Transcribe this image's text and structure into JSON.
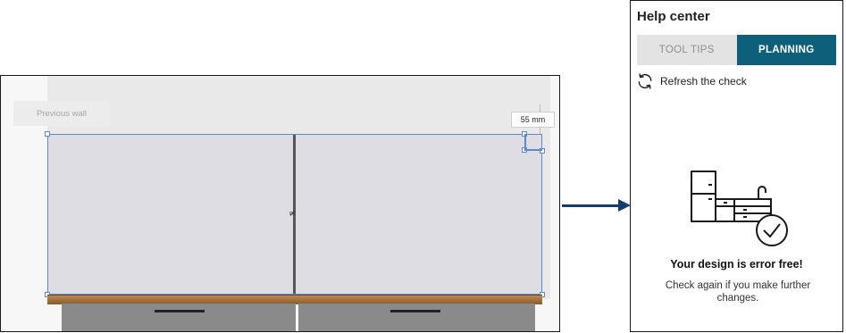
{
  "canvas": {
    "previous_wall_label": "Previous wall",
    "dimension_label": "55 mm",
    "divider_mark": "≠"
  },
  "help_center": {
    "title": "Help center",
    "tabs": [
      {
        "label": "TOOL TIPS",
        "active": false
      },
      {
        "label": "PLANNING",
        "active": true
      }
    ],
    "refresh_label": "Refresh the check",
    "refresh_icon": "refresh-icon",
    "illustration_icon": "kitchen-check-icon",
    "status_title": "Your design is error free!",
    "status_desc": "Check again if you make further changes."
  },
  "colors": {
    "accent": "#0e5f7a",
    "selection": "#5b8ad1",
    "arrow": "#123e6c"
  }
}
